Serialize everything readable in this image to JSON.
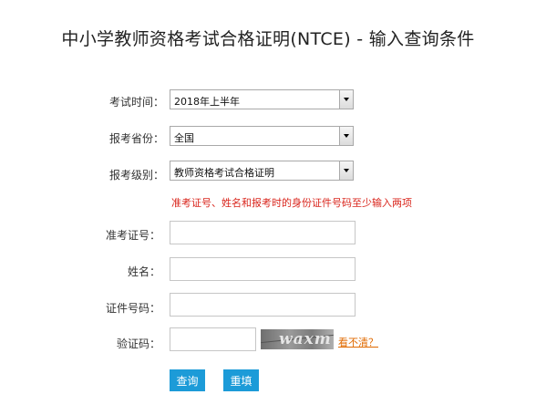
{
  "page": {
    "title": "中小学教师资格考试合格证明(NTCE) - 输入查询条件"
  },
  "form": {
    "exam_time": {
      "label": "考试时间：",
      "value": "2018年上半年"
    },
    "province": {
      "label": "报考省份：",
      "value": "全国"
    },
    "level": {
      "label": "报考级别：",
      "value": "教师资格考试合格证明"
    },
    "notice": "准考证号、姓名和报考时的身份证件号码至少输入两项",
    "ticket_no": {
      "label": "准考证号：",
      "value": ""
    },
    "name": {
      "label": "姓名：",
      "value": ""
    },
    "id_no": {
      "label": "证件号码：",
      "value": ""
    },
    "captcha": {
      "label": "验证码：",
      "value": "",
      "image_text": "waxm",
      "refresh_link": "看不清？"
    }
  },
  "buttons": {
    "query": "查询",
    "reset": "重填"
  },
  "colors": {
    "notice": "#d9251c",
    "button": "#1c9bd8",
    "link": "#e06a00"
  }
}
